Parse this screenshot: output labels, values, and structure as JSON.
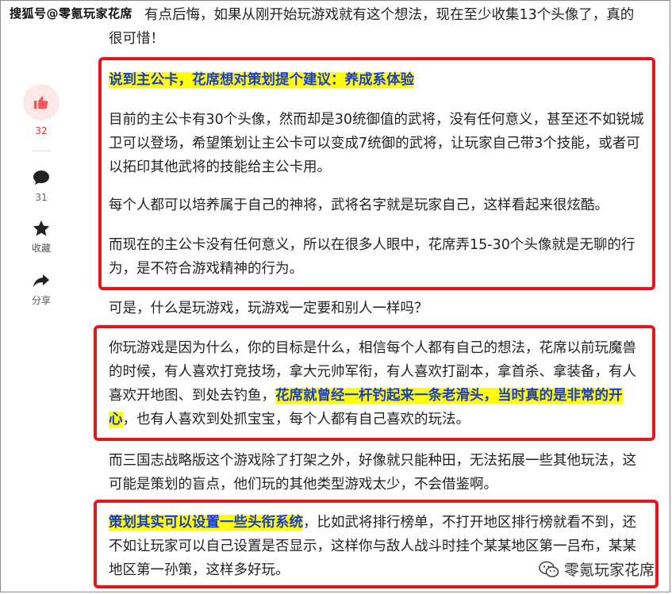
{
  "watermark_top": "搜狐号@零氪玩家花席",
  "watermark_bottom": "零氪玩家花席",
  "sidebar": {
    "like_count": "32",
    "comment_count": "31",
    "favorite_label": "收藏",
    "share_label": "分享"
  },
  "paragraphs": {
    "p0_line1": "有点后悔，如果从刚开始玩游戏就有这个想法，现在至少收集13个头像了，真的",
    "p0_line2": "很可惜！",
    "p1_heading": "说到主公卡，花席想对策划提个建议：养成系体验",
    "p2": "目前的主公卡有30个头像，然而却是30统御值的武将，没有任何意义，甚至还不如锐城卫可以登场，希望策划让主公卡可以变成7统御的武将，让玩家自己带3个技能，或者可以拓印其他武将的技能给主公卡用。",
    "p3": "每个人都可以培养属于自己的神将，武将名字就是玩家自己，这样看起来很炫酷。",
    "p4": "而现在的主公卡没有任何意义，所以在很多人眼中，花席弄15-30个头像就是无聊的行为，是不符合游戏精神的行为。",
    "p5": "可是，什么是玩游戏，玩游戏一定要和别人一样吗？",
    "p6_a": "你玩游戏是因为什么，你的目标是什么，相信每个人都有自己的想法，花席以前玩魔兽的时候，有人喜欢打竞技场，拿大元帅军衔，有人喜欢打副本，拿首杀、拿装备，有人喜欢开地图、到处去钓鱼，",
    "p6_hl": "花席就曾经一杆钓起来一条老滑头，当时真的是非常的开心",
    "p6_b": "，也有人喜欢到处抓宝宝，每个人都有自己喜欢的玩法。",
    "p7": "而三国志战略版这个游戏除了打架之外，好像就只能种田，无法拓展一些其他玩法，这可能是策划的盲点，他们玩的其他类型游戏太少，不会借鉴啊。",
    "p8_hl": "策划其实可以设置一些头衔系统",
    "p8_rest": "，比如武将排行榜单，不打开地区排行榜就看不到，还不如让玩家可以自己设置是否显示，这样你与敌人战斗时挂个某某地区第一吕布，某某地区第一孙策，这样多好玩。"
  },
  "colors": {
    "highlight_bg": "#ffff00",
    "highlight_text": "#1a3cd6",
    "box_border": "#e8141c"
  }
}
